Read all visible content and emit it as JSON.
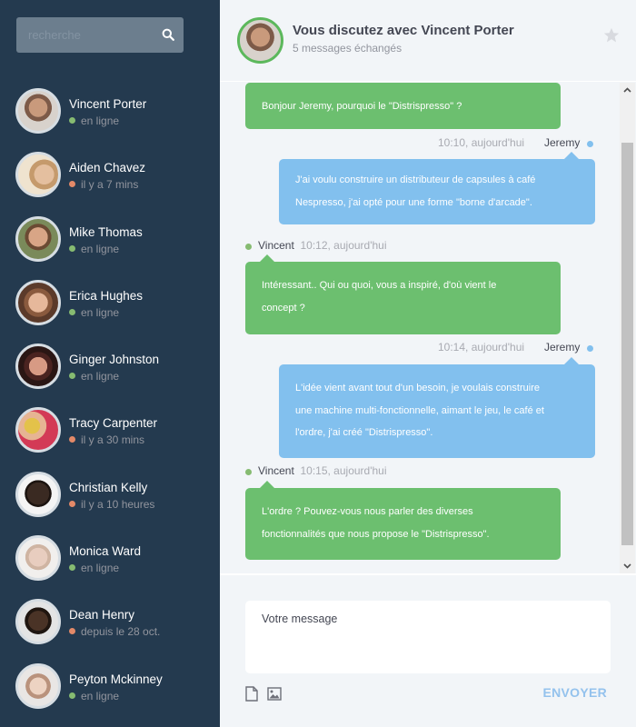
{
  "search": {
    "placeholder": "recherche",
    "icon": "search-icon"
  },
  "colors": {
    "sidebar_bg": "#243a4f",
    "online": "#86bb71",
    "away": "#e38968",
    "bubble_vincent": "#6cbf6f",
    "bubble_jeremy": "#82c0ee",
    "send": "#94c2ed"
  },
  "contacts": [
    {
      "name": "Vincent Porter",
      "status": "en ligne",
      "state": "online"
    },
    {
      "name": "Aiden Chavez",
      "status": "il y a 7 mins",
      "state": "away"
    },
    {
      "name": "Mike Thomas",
      "status": "en ligne",
      "state": "online"
    },
    {
      "name": "Erica Hughes",
      "status": "en ligne",
      "state": "online"
    },
    {
      "name": "Ginger Johnston",
      "status": "en ligne",
      "state": "online"
    },
    {
      "name": "Tracy Carpenter",
      "status": "il y a 30 mins",
      "state": "away"
    },
    {
      "name": "Christian Kelly",
      "status": "il y a 10 heures",
      "state": "away"
    },
    {
      "name": "Monica Ward",
      "status": "en ligne",
      "state": "online"
    },
    {
      "name": "Dean Henry",
      "status": "depuis le 28 oct.",
      "state": "away"
    },
    {
      "name": "Peyton Mckinney",
      "status": "en ligne",
      "state": "online"
    }
  ],
  "header": {
    "title": "Vous discutez avec Vincent Porter",
    "subtitle": "5 messages échangés",
    "star_icon": "star-icon"
  },
  "messages": [
    {
      "author": "Vincent",
      "time": "",
      "side": "left",
      "lines": [
        "Bonjour Jeremy, pourquoi le \"Distrispresso\" ?"
      ]
    },
    {
      "author": "Jeremy",
      "time": "10:10, aujourd'hui",
      "side": "right",
      "lines": [
        "J'ai voulu construire un distributeur de capsules à café",
        "Nespresso, j'ai opté pour une forme \"borne d'arcade\"."
      ]
    },
    {
      "author": "Vincent",
      "time": "10:12, aujourd'hui",
      "side": "left",
      "lines": [
        "Intéressant.. Qui ou quoi, vous a inspiré, d'où vient le",
        "concept ?"
      ]
    },
    {
      "author": "Jeremy",
      "time": "10:14, aujourd'hui",
      "side": "right",
      "lines": [
        "L'idée vient avant tout d'un besoin, je voulais construire",
        "une machine multi-fonctionnelle, aimant le jeu, le café et",
        "l'ordre, j'ai créé \"Distrispresso\"."
      ]
    },
    {
      "author": "Vincent",
      "time": "10:15, aujourd'hui",
      "side": "left",
      "lines": [
        "L'ordre ? Pouvez-vous nous parler des diverses",
        "fonctionnalités que nous propose le \"Distrispresso\"."
      ]
    }
  ],
  "composer": {
    "placeholder": "Votre message",
    "send_label": "ENVOYER",
    "attach_icon": "file-icon",
    "image_icon": "image-icon"
  }
}
